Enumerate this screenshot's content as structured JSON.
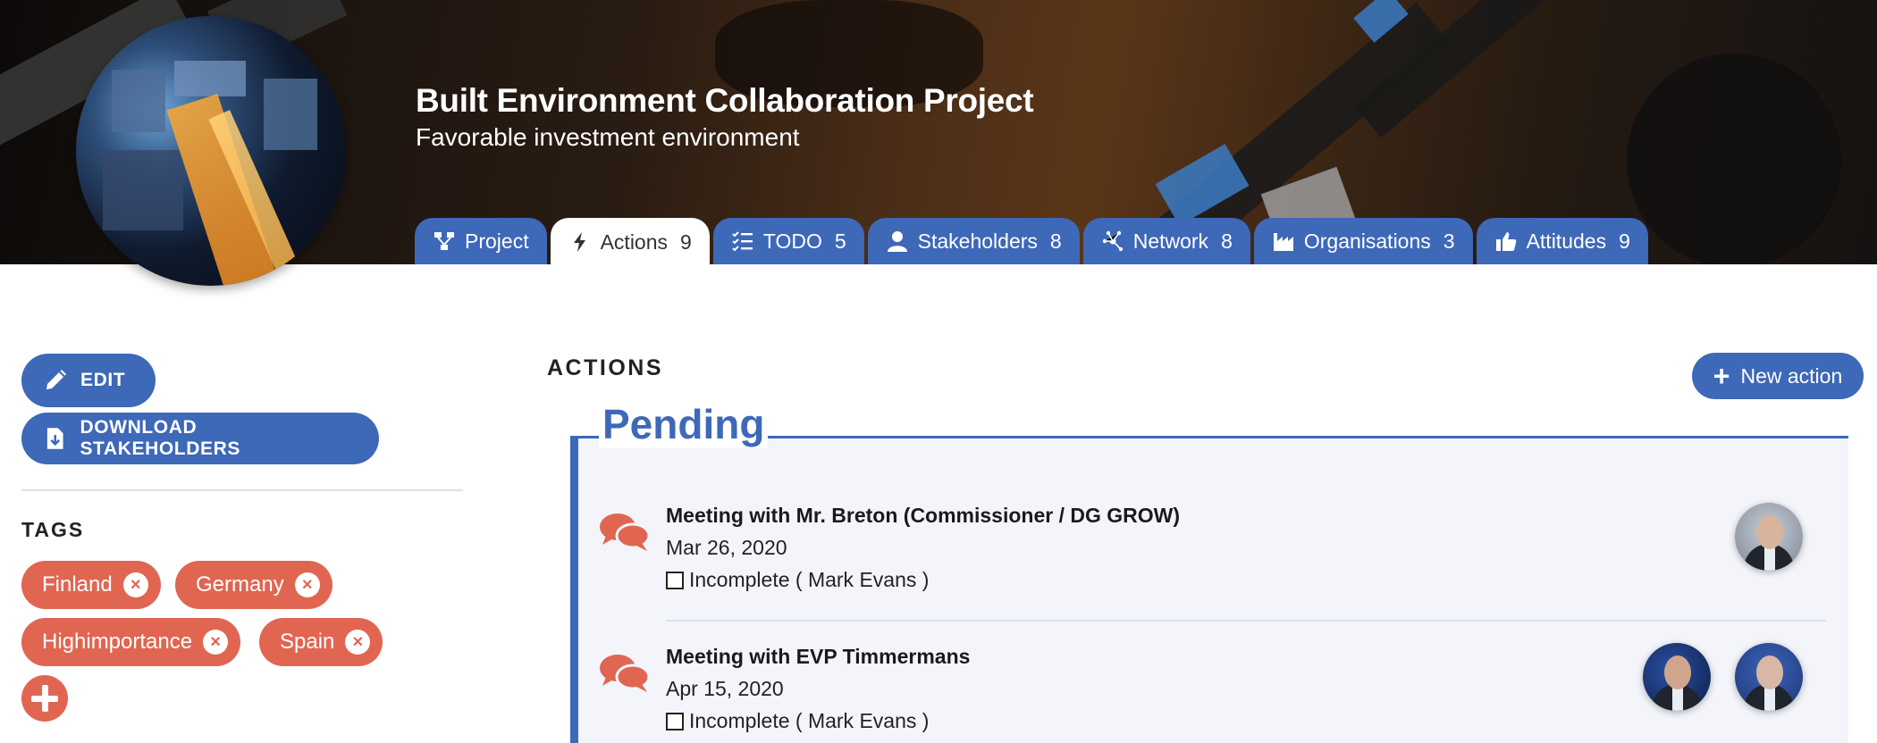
{
  "header": {
    "title": "Built Environment Collaboration Project",
    "subtitle": "Favorable investment environment"
  },
  "tabs": [
    {
      "label": "Project",
      "count": "",
      "icon": "project-icon"
    },
    {
      "label": "Actions",
      "count": "9",
      "icon": "bolt-icon",
      "active": true
    },
    {
      "label": "TODO",
      "count": "5",
      "icon": "checklist-icon"
    },
    {
      "label": "Stakeholders",
      "count": "8",
      "icon": "user-icon"
    },
    {
      "label": "Network",
      "count": "8",
      "icon": "network-icon"
    },
    {
      "label": "Organisations",
      "count": "3",
      "icon": "factory-icon"
    },
    {
      "label": "Attitudes",
      "count": "9",
      "icon": "thumbs-up-icon"
    }
  ],
  "sidebar": {
    "edit_label": "EDIT",
    "download_label": "DOWNLOAD STAKEHOLDERS",
    "tags_title": "TAGS",
    "tags": [
      "Finland",
      "Germany",
      "Highimportance",
      "Spain"
    ],
    "remove_symbol": "×"
  },
  "main": {
    "heading": "ACTIONS",
    "new_action_label": "New action",
    "new_action_symbol": "+",
    "pending_title": "Pending",
    "actions": [
      {
        "title": "Meeting with Mr. Breton (Commissioner / DG GROW)",
        "date": "Mar 26, 2020",
        "status": "Incomplete ( Mark Evans )",
        "participants": 1
      },
      {
        "title": "Meeting with EVP Timmermans",
        "date": "Apr 15, 2020",
        "status": "Incomplete ( Mark Evans )",
        "participants": 2
      }
    ]
  },
  "colors": {
    "primary": "#3e68b8",
    "tag": "#e06652",
    "pending_bg": "#f3f5fb"
  }
}
